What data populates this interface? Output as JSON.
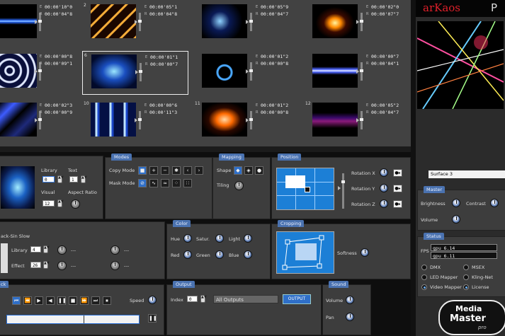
{
  "app": {
    "logo": "arKaos",
    "logo_suffix": "P",
    "bottom_logo_line1": "Media",
    "bottom_logo_line2": "Master",
    "bottom_logo_line3": "pro"
  },
  "clips": [
    {
      "num": "",
      "e": "00:00'10\"0",
      "r": "00:00'04\"8"
    },
    {
      "num": "2",
      "e": "00:00'05\"1",
      "r": "00:00'04\"8"
    },
    {
      "num": "",
      "e": "00:00'05\"9",
      "r": "00:00'04\"7"
    },
    {
      "num": "",
      "e": "00:00'02\"0",
      "r": "00:00'07\"7"
    },
    {
      "num": "",
      "e": "00:00'00\"8",
      "r": "00:00'09\"1"
    },
    {
      "num": "6",
      "e": "00:00'01\"1",
      "r": "00:00'00\"7"
    },
    {
      "num": "",
      "e": "00:00'01\"2",
      "r": "00:00'00\"8"
    },
    {
      "num": "",
      "e": "00:00'00\"7",
      "r": "00:00'04\"1"
    },
    {
      "num": "",
      "e": "00:00'02\"3",
      "r": "00:00'00\"9"
    },
    {
      "num": "10",
      "e": "00:00'00\"6",
      "r": "00:00'11\"3"
    },
    {
      "num": "11",
      "e": "00:00'01\"2",
      "r": "00:00'00\"8"
    },
    {
      "num": "12",
      "e": "00:00'05\"2",
      "r": "00:00'04\"7"
    }
  ],
  "clip_label_e": "E",
  "clip_label_r": "R",
  "preview_panel": {
    "library_label": "Library",
    "text_label": "Text",
    "visual_label": "Visual",
    "aspect_label": "Aspect Ratio",
    "library_value": "0",
    "text_value": "1",
    "visual_value": "12"
  },
  "modes": {
    "title": "Modes",
    "copy_label": "Copy Mode",
    "mask_label": "Mask Mode"
  },
  "mapping": {
    "title": "Mapping",
    "shape_label": "Shape",
    "tiling_label": "Tiling"
  },
  "position": {
    "title": "Position",
    "rot_x": "Rotation X",
    "rot_y": "Rotation Y",
    "rot_z": "Rotation Z"
  },
  "effect_panel": {
    "name": "ack-Sin Slow",
    "library_label": "Library",
    "effect_label": "Effect",
    "library_value": "4",
    "effect_value": "26",
    "dash": "---"
  },
  "color": {
    "title": "Color",
    "hue": "Hue",
    "satur": "Satur.",
    "light": "Light",
    "red": "Red",
    "green": "Green",
    "blue": "Blue"
  },
  "cropping": {
    "title": "Cropping",
    "softness": "Softness"
  },
  "transport": {
    "title": "ck",
    "speed": "Speed"
  },
  "output": {
    "title": "Output",
    "index_label": "Index",
    "index_value": "0",
    "outputs_value": "All Outputs",
    "output_btn": "OUTPUT"
  },
  "sound": {
    "title": "Sound",
    "volume": "Volume",
    "pan": "Pan"
  },
  "right": {
    "surface": "Surface 3"
  },
  "master": {
    "title": "Master",
    "brightness": "Brightness",
    "contrast": "Contrast",
    "volume": "Volume"
  },
  "status": {
    "title": "Status",
    "fps_label": "FPS",
    "gpu1": "gpu 6.14",
    "gpu2": "gpu 6.11",
    "dmx": "DMX",
    "msex": "MSEX",
    "led": "LED Mapper",
    "kling": "Kling-Net",
    "video": "Video Mapper",
    "license": "License"
  }
}
